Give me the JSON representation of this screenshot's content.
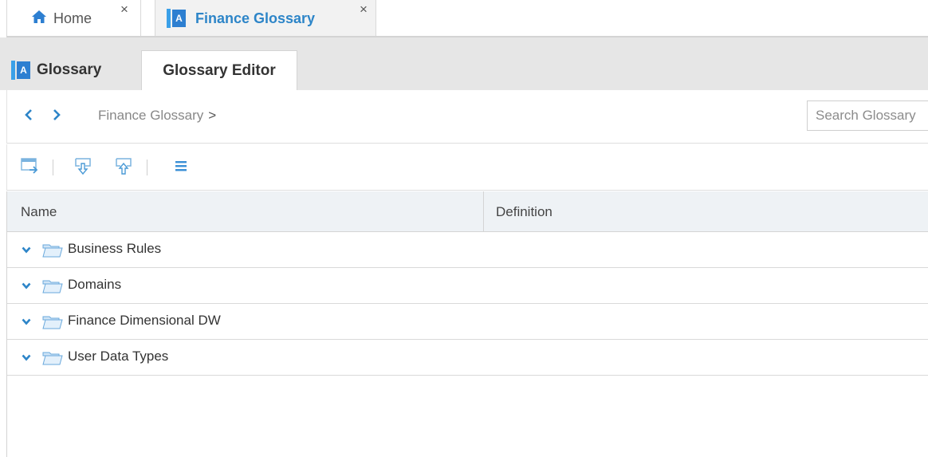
{
  "top_tabs": [
    {
      "label": "Home",
      "close": "×"
    },
    {
      "label": "Finance Glossary",
      "icon_text": "A",
      "close": "×"
    }
  ],
  "sub_tabs": [
    {
      "label": "Glossary",
      "icon_text": "A"
    },
    {
      "label": "Glossary Editor"
    }
  ],
  "breadcrumb": {
    "back": "‹",
    "forward": "›",
    "path": "Finance Glossary",
    "separator": ">"
  },
  "search": {
    "placeholder": "Search Glossary",
    "value": ""
  },
  "toolbar": {
    "icons": [
      "export-window-icon",
      "import-down-icon",
      "export-up-icon",
      "list-menu-icon"
    ]
  },
  "table": {
    "columns": [
      "Name",
      "Definition"
    ],
    "rows": [
      {
        "name": "Business Rules",
        "definition": ""
      },
      {
        "name": "Domains",
        "definition": ""
      },
      {
        "name": "Finance Dimensional DW",
        "definition": ""
      },
      {
        "name": "User Data Types",
        "definition": ""
      }
    ]
  },
  "colors": {
    "accent": "#2d85c8",
    "tab_bar": "#e6e6e6",
    "header_bg": "#eef2f5",
    "folder": "#9ec7ef"
  }
}
